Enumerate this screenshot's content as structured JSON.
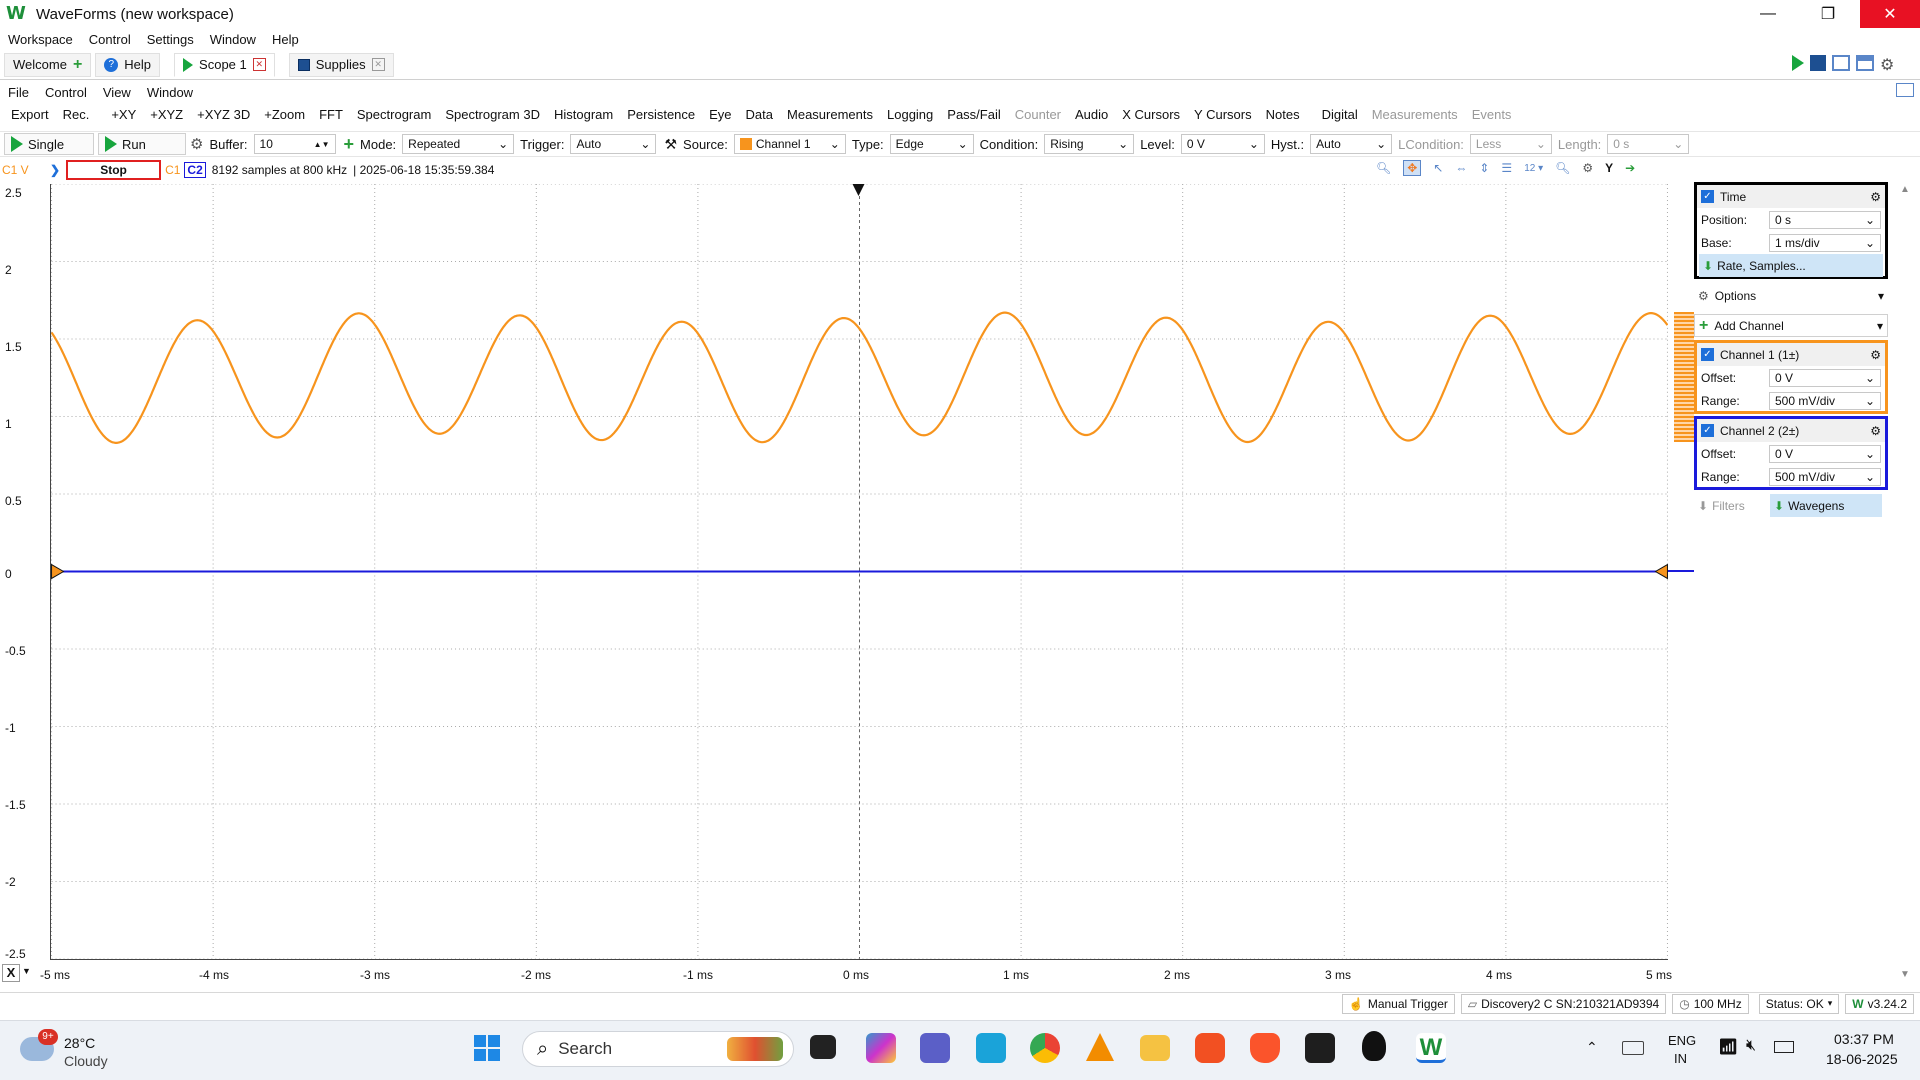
{
  "window": {
    "title": "WaveForms (new workspace)",
    "logo": "W"
  },
  "menu": [
    "Workspace",
    "Control",
    "Settings",
    "Window",
    "Help"
  ],
  "tabs": [
    {
      "label": "Welcome",
      "icon": "plus-icon"
    },
    {
      "label": "Help",
      "icon": "help-icon"
    },
    {
      "label": "Scope 1",
      "icon": "play-icon",
      "active": true
    },
    {
      "label": "Supplies",
      "icon": "stop-icon"
    }
  ],
  "submenu": [
    "File",
    "Control",
    "View",
    "Window"
  ],
  "tools": {
    "items": [
      "Export",
      "Rec.",
      "+XY",
      "+XYZ",
      "+XYZ 3D",
      "+Zoom",
      "FFT",
      "Spectrogram",
      "Spectrogram 3D",
      "Histogram",
      "Persistence",
      "Eye",
      "Data",
      "Measurements",
      "Logging",
      "Pass/Fail"
    ],
    "disabled_items": [
      "Counter"
    ],
    "items2": [
      "Audio",
      "X Cursors",
      "Y Cursors",
      "Notes",
      "Digital"
    ],
    "disabled_items2": [
      "Measurements",
      "Events"
    ]
  },
  "controls": {
    "single": "Single",
    "run": "Run",
    "buffer_label": "Buffer:",
    "buffer_value": "10",
    "mode_label": "Mode:",
    "mode_value": "Repeated",
    "trigger_label": "Trigger:",
    "trigger_value": "Auto",
    "source_label": "Source:",
    "source_value": "Channel 1",
    "type_label": "Type:",
    "type_value": "Edge",
    "condition_label": "Condition:",
    "condition_value": "Rising",
    "level_label": "Level:",
    "level_value": "0 V",
    "hyst_label": "Hyst.:",
    "hyst_value": "Auto",
    "lcondition_label": "LCondition:",
    "lcondition_value": "Less",
    "length_label": "Length:",
    "length_value": "0 s"
  },
  "info": {
    "channel": "C1 V",
    "status": "Stop",
    "c1": "C1",
    "c2": "C2",
    "samples": "8192 samples at 800 kHz",
    "timestamp": "| 2025-06-18 15:35:59.384",
    "y_button": "Y"
  },
  "plot": {
    "y_ticks": [
      "2.5",
      "2",
      "1.5",
      "1",
      "0.5",
      "0",
      "-0.5",
      "-1",
      "-1.5",
      "-2",
      "-2.5"
    ],
    "x_ticks": [
      "-5 ms",
      "-4 ms",
      "-3 ms",
      "-2 ms",
      "-1 ms",
      "0 ms",
      "1 ms",
      "2 ms",
      "3 ms",
      "4 ms",
      "5 ms"
    ],
    "x_marker": "X",
    "channel1_color": "#f7941d",
    "channel2_color": "#1a1adb",
    "channel1_signal": {
      "center_v": 1.25,
      "amplitude_v": 0.39,
      "period_ms": 1.0,
      "phase_ms_at_peak": -4.1
    },
    "channel2_signal": {
      "level_v": 0
    }
  },
  "panel": {
    "time": {
      "title": "Time",
      "position_label": "Position:",
      "position_value": "0 s",
      "base_label": "Base:",
      "base_value": "1 ms/div",
      "rate_link": "Rate, Samples..."
    },
    "options": "Options",
    "add_channel": "Add Channel",
    "ch1": {
      "title": "Channel 1 (1±)",
      "offset_label": "Offset:",
      "offset_value": "0 V",
      "range_label": "Range:",
      "range_value": "500 mV/div"
    },
    "ch2": {
      "title": "Channel 2 (2±)",
      "offset_label": "Offset:",
      "offset_value": "0 V",
      "range_label": "Range:",
      "range_value": "500 mV/div"
    },
    "filters": "Filters",
    "wavegens": "Wavegens"
  },
  "status": {
    "manual_trigger": "Manual Trigger",
    "device": "Discovery2 C SN:210321AD9394",
    "freq": "100 MHz",
    "status": "Status: OK",
    "version": "v3.24.2"
  },
  "taskbar": {
    "temp": "28°C",
    "weather": "Cloudy",
    "badge": "9+",
    "search": "Search",
    "lang": "ENG",
    "region": "IN",
    "time": "03:37 PM",
    "date": "18-06-2025"
  }
}
